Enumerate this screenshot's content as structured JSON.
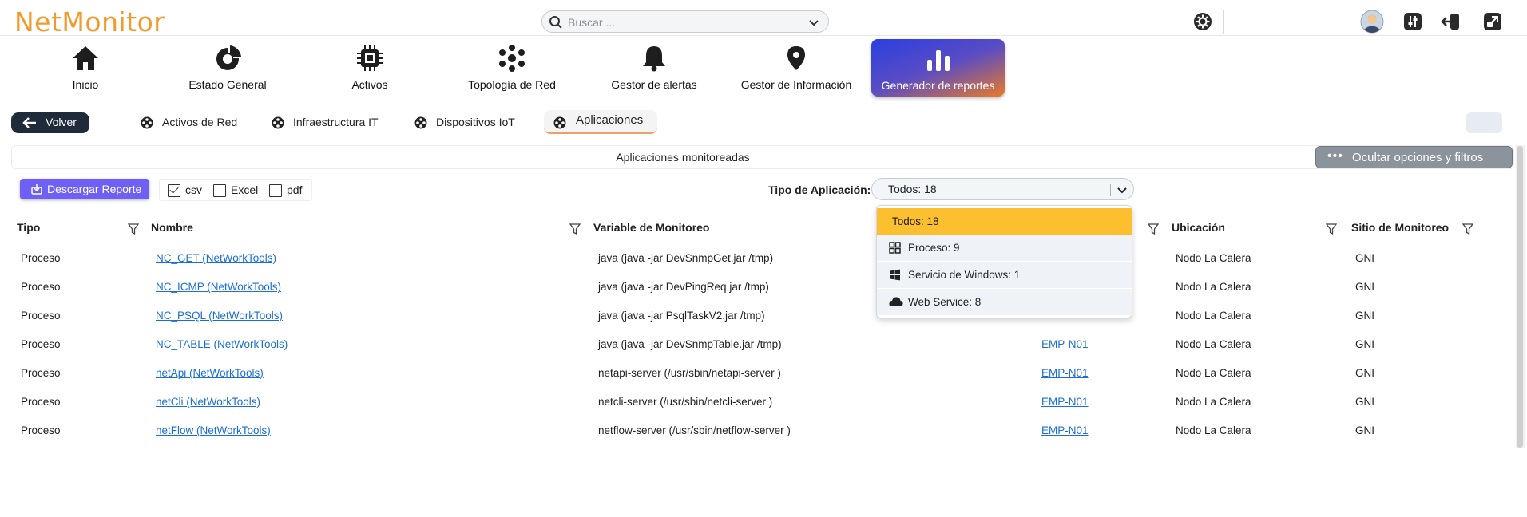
{
  "header": {
    "logo": "NetMonitor",
    "search": {
      "placeholder": "Buscar ..."
    }
  },
  "nav": [
    {
      "label": "Inicio",
      "icon": "home-icon"
    },
    {
      "label": "Estado General",
      "icon": "donut-chart-icon"
    },
    {
      "label": "Activos",
      "icon": "chip-icon"
    },
    {
      "label": "Topología de Red",
      "icon": "network-icon"
    },
    {
      "label": "Gestor de alertas",
      "icon": "bell-icon"
    },
    {
      "label": "Gestor de Información",
      "icon": "location-pin-icon"
    },
    {
      "label": "Generador de reportes",
      "icon": "bar-chart-icon",
      "active": true
    }
  ],
  "subnav": {
    "back_label": "Volver",
    "tabs": [
      {
        "label": "Activos de Red"
      },
      {
        "label": "Infraestructura IT"
      },
      {
        "label": "Dispositivos IoT"
      },
      {
        "label": "Aplicaciones",
        "active": true
      }
    ]
  },
  "panel": {
    "title": "Aplicaciones monitoreadas",
    "hide_button": "Ocultar opciones y filtros"
  },
  "toolbar": {
    "download_label": "Descargar Reporte",
    "formats": [
      {
        "label": "csv",
        "checked": true
      },
      {
        "label": "Excel",
        "checked": false
      },
      {
        "label": "pdf",
        "checked": false
      }
    ],
    "type_label": "Tipo de Aplicación:",
    "type_value": "Todos: 18"
  },
  "dropdown": {
    "options": [
      {
        "label": "Todos: 18",
        "selected": true
      },
      {
        "label": "Proceso: 9",
        "icon": "grid-icon"
      },
      {
        "label": "Servicio de Windows: 1",
        "icon": "windows-icon"
      },
      {
        "label": "Web Service: 8",
        "icon": "cloud-icon"
      }
    ]
  },
  "table": {
    "columns": [
      "Tipo",
      "Nombre",
      "Variable de Monitoreo",
      "Ubicación",
      "Sitio de Monitoreo"
    ],
    "rows": [
      {
        "tipo": "Proceso",
        "nombre": "NC_GET (NetWorkTools)",
        "variable": "java (java -jar DevSnmpGet.jar /tmp)",
        "equipo": "",
        "ubicacion": "Nodo La Calera",
        "sitio": "GNI"
      },
      {
        "tipo": "Proceso",
        "nombre": "NC_ICMP (NetWorkTools)",
        "variable": "java (java -jar DevPingReq.jar /tmp)",
        "equipo": "",
        "ubicacion": "Nodo La Calera",
        "sitio": "GNI"
      },
      {
        "tipo": "Proceso",
        "nombre": "NC_PSQL (NetWorkTools)",
        "variable": "java (java -jar PsqlTaskV2.jar /tmp)",
        "equipo": "",
        "ubicacion": "Nodo La Calera",
        "sitio": "GNI"
      },
      {
        "tipo": "Proceso",
        "nombre": "NC_TABLE (NetWorkTools)",
        "variable": "java (java -jar DevSnmpTable.jar /tmp)",
        "equipo": "EMP-N01",
        "ubicacion": "Nodo La Calera",
        "sitio": "GNI"
      },
      {
        "tipo": "Proceso",
        "nombre": "netApi (NetWorkTools)",
        "variable": "netapi-server (/usr/sbin/netapi-server )",
        "equipo": "EMP-N01",
        "ubicacion": "Nodo La Calera",
        "sitio": "GNI"
      },
      {
        "tipo": "Proceso",
        "nombre": "netCli (NetWorkTools)",
        "variable": "netcli-server (/usr/sbin/netcli-server )",
        "equipo": "EMP-N01",
        "ubicacion": "Nodo La Calera",
        "sitio": "GNI"
      },
      {
        "tipo": "Proceso",
        "nombre": "netFlow (NetWorkTools)",
        "variable": "netflow-server (/usr/sbin/netflow-server )",
        "equipo": "EMP-N01",
        "ubicacion": "Nodo La Calera",
        "sitio": "GNI"
      }
    ]
  },
  "colors": {
    "logo": "#f29a2b",
    "accent": "#6e5ff5",
    "selected_option": "#fbbf2f",
    "link": "#1a6fd6"
  }
}
